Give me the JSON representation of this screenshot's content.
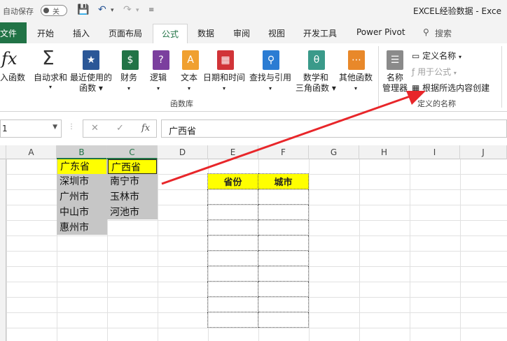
{
  "titlebar": {
    "autosave_label": "自动保存",
    "autosave_state": "关",
    "app_title": "EXCEL经验数据 - Exce"
  },
  "tabs": {
    "file": "文件",
    "items": [
      "开始",
      "插入",
      "页面布局",
      "公式",
      "数据",
      "审阅",
      "视图",
      "开发工具",
      "Power Pivot"
    ],
    "active": "公式",
    "search": "搜索"
  },
  "ribbon": {
    "insert_function": "入函数",
    "autosum": "自动求和",
    "recent": "最近使用的",
    "recent2": "函数",
    "finance": "财务",
    "logic": "逻辑",
    "text": "文本",
    "datetime": "日期和时间",
    "lookup": "查找与引用",
    "math": "数学和",
    "math2": "三角函数",
    "other": "其他函数",
    "group_library": "函数库",
    "name_manager": "名称",
    "name_manager2": "管理器",
    "define_name": "定义名称",
    "use_in_formula": "用于公式",
    "create_from_selection": "根据所选内容创建",
    "group_defined_names": "定义的名称"
  },
  "formula_bar": {
    "name_box": "1",
    "formula": "广西省"
  },
  "columns": [
    "A",
    "B",
    "C",
    "D",
    "E",
    "F",
    "G",
    "H",
    "I",
    "J"
  ],
  "sheet": {
    "col_b": [
      "广东省",
      "深圳市",
      "广州市",
      "中山市",
      "惠州市"
    ],
    "col_c": [
      "广西省",
      "南宁市",
      "玉林市",
      "河池市"
    ],
    "table_headers": [
      "省份",
      "城市"
    ]
  },
  "colors": {
    "accent": "#217346",
    "highlight": "#ffff00",
    "arrow": "#e8262a"
  }
}
